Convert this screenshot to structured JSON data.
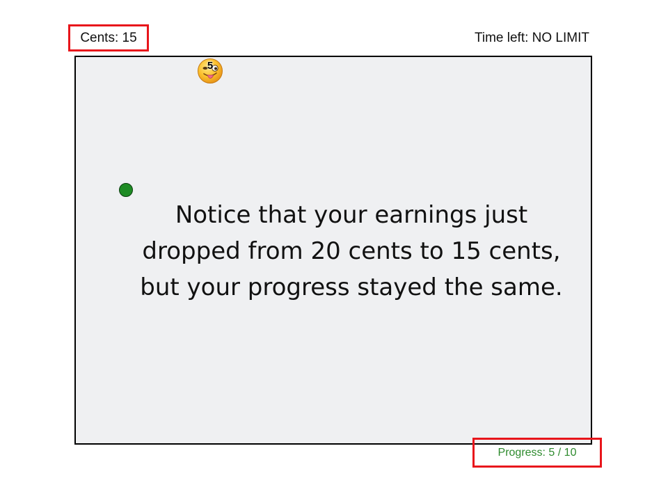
{
  "hud": {
    "cents_text": "Cents: 15",
    "time_text": "Time left: NO LIMIT",
    "progress_text": "Progress: 5 / 10"
  },
  "game": {
    "token_number": "5",
    "token_icon": "tongue-out-emoji-icon",
    "player_dot_color": "#1e8b24",
    "instruction": "Notice that your earnings just dropped from 20 cents to 15 cents, but your progress stayed the same."
  },
  "colors": {
    "highlight_border": "#e8151b",
    "progress_text": "#2d8a2d",
    "board_background": "#eff0f2"
  }
}
